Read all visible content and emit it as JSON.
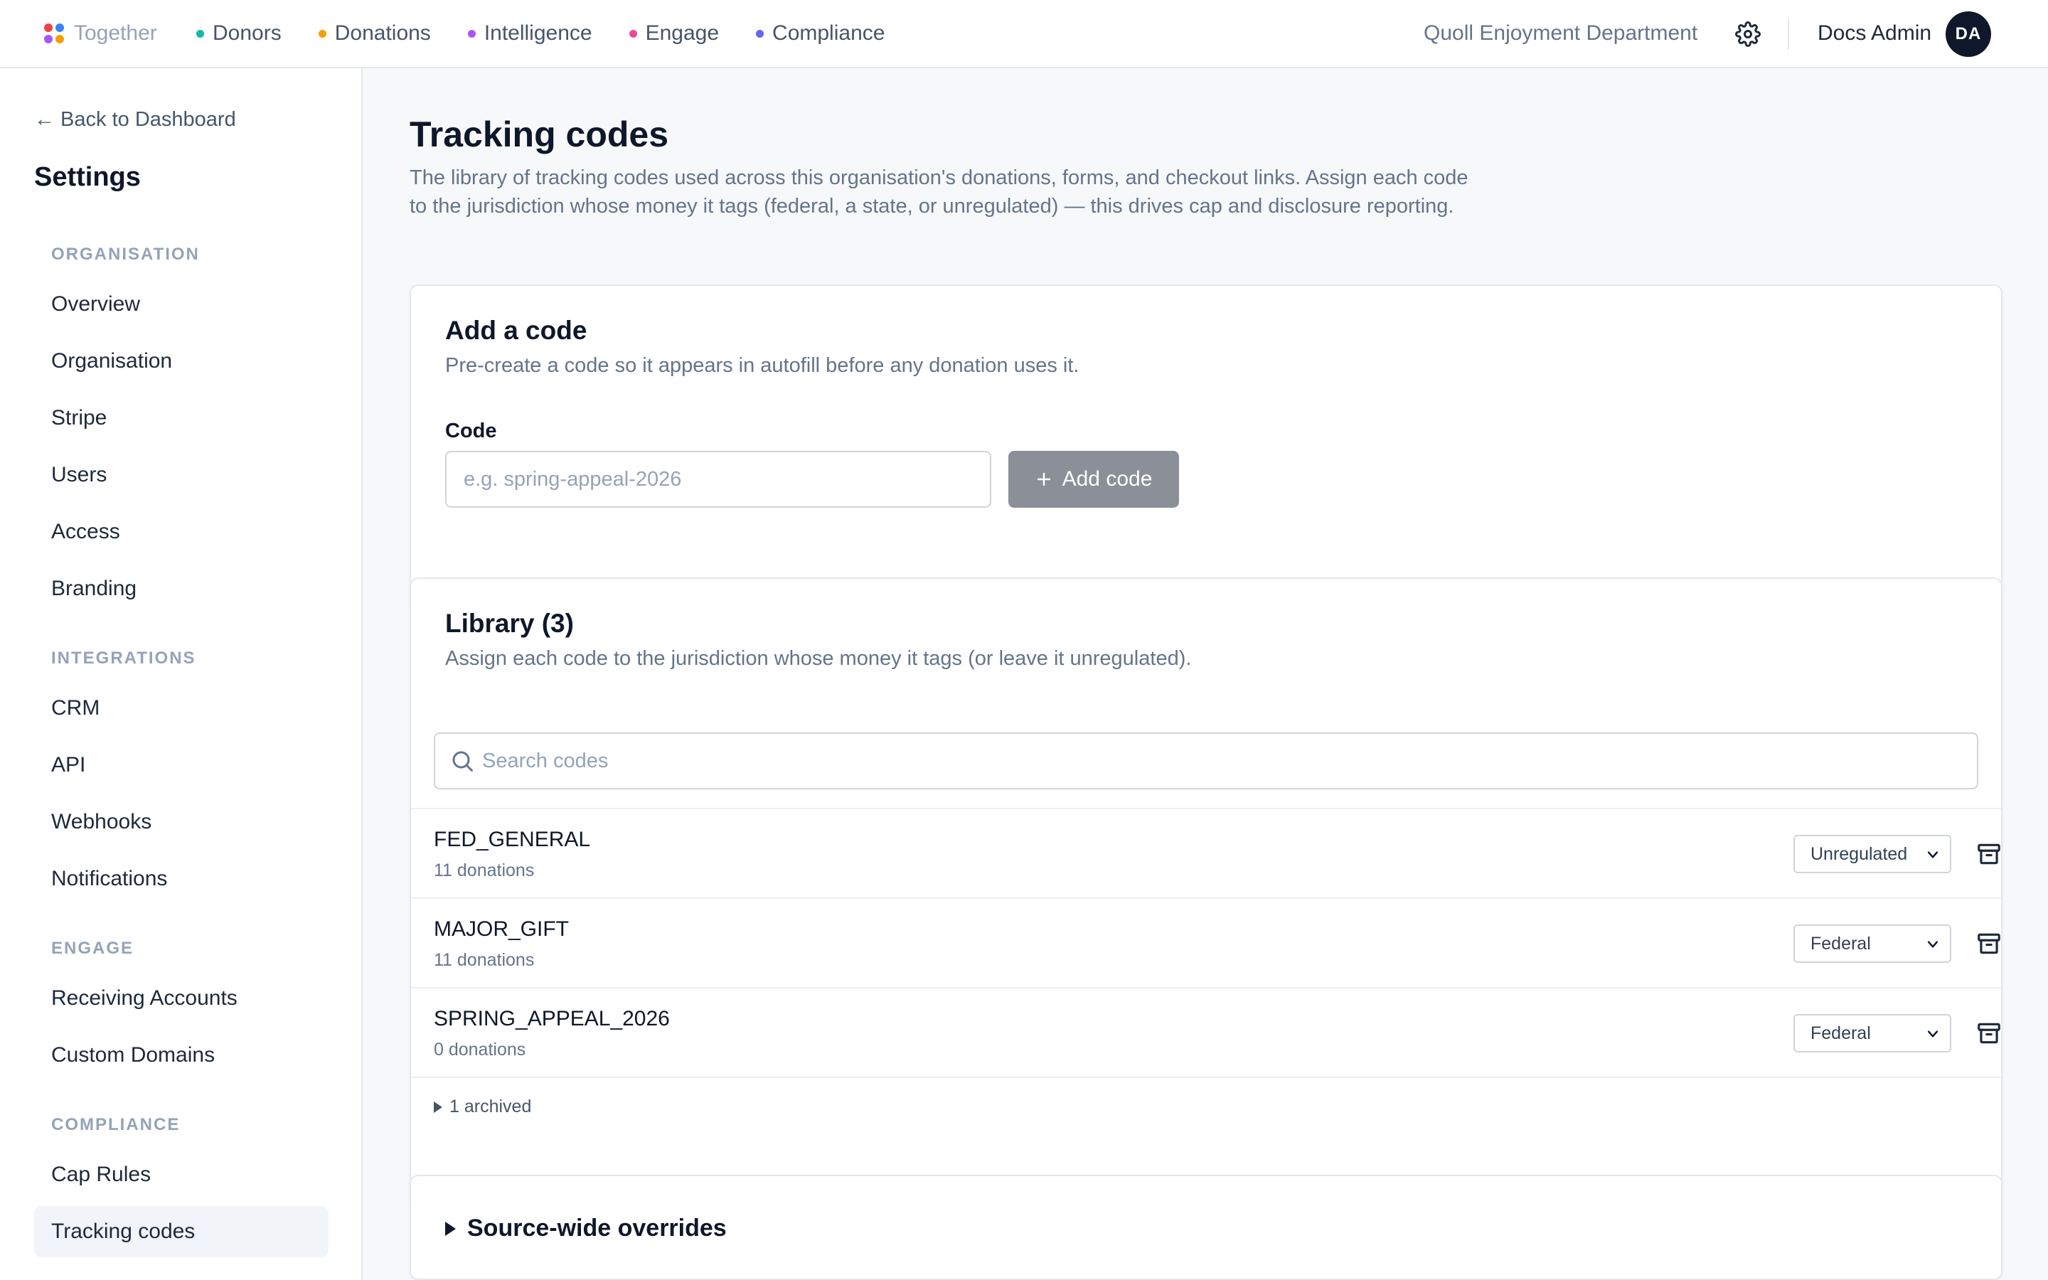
{
  "brand": {
    "name": "Together",
    "logo_colors": [
      "#ef4444",
      "#3b82f6",
      "#a855f7",
      "#f59e0b"
    ]
  },
  "nav": [
    {
      "label": "Donors",
      "color": "#14b8a6"
    },
    {
      "label": "Donations",
      "color": "#f59e0b"
    },
    {
      "label": "Intelligence",
      "color": "#a855f7"
    },
    {
      "label": "Engage",
      "color": "#ec4899"
    },
    {
      "label": "Compliance",
      "color": "#6366f1"
    }
  ],
  "header": {
    "org_name": "Quoll Enjoyment Department",
    "settings_icon": "gear-icon",
    "user_name": "Docs Admin",
    "user_initials": "DA"
  },
  "sidebar": {
    "back_label": "← Back to Dashboard",
    "title": "Settings",
    "sections": [
      {
        "label": "ORGANISATION",
        "items": [
          "Overview",
          "Organisation",
          "Stripe",
          "Users",
          "Access",
          "Branding"
        ]
      },
      {
        "label": "INTEGRATIONS",
        "items": [
          "CRM",
          "API",
          "Webhooks",
          "Notifications"
        ]
      },
      {
        "label": "ENGAGE",
        "items": [
          "Receiving Accounts",
          "Custom Domains"
        ]
      },
      {
        "label": "COMPLIANCE",
        "items": [
          "Cap Rules",
          "Tracking codes"
        ]
      }
    ],
    "active_item": "Tracking codes"
  },
  "main": {
    "title": "Tracking codes",
    "description": "The library of tracking codes used across this organisation's donations, forms, and checkout links. Assign each code to the jurisdiction whose money it tags (federal, a state, or unregulated) — this drives cap and disclosure reporting.",
    "add_card": {
      "title": "Add a code",
      "subtitle": "Pre-create a code so it appears in autofill before any donation uses it.",
      "field_label": "Code",
      "placeholder": "e.g. spring-appeal-2026",
      "button_label": "Add code"
    },
    "library": {
      "title": "Library (3)",
      "subtitle": "Assign each code to the jurisdiction whose money it tags (or leave it unregulated).",
      "search_placeholder": "Search codes",
      "rows": [
        {
          "code": "FED_GENERAL",
          "count": "11 donations",
          "jurisdiction": "Unregulated"
        },
        {
          "code": "MAJOR_GIFT",
          "count": "11 donations",
          "jurisdiction": "Federal"
        },
        {
          "code": "SPRING_APPEAL_2026",
          "count": "0 donations",
          "jurisdiction": "Federal"
        }
      ],
      "archived_label": "1 archived"
    },
    "overrides": {
      "title": "Source-wide overrides"
    }
  }
}
